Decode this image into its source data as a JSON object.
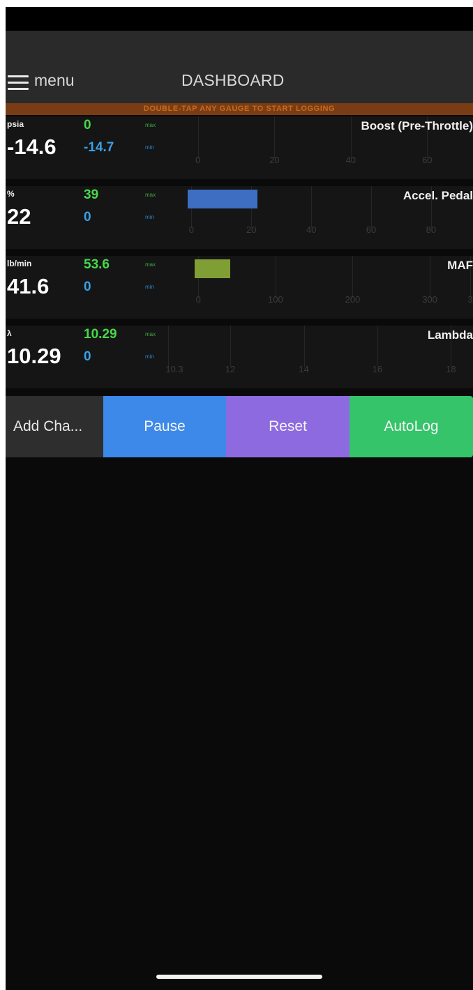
{
  "header": {
    "menu_label": "menu",
    "title": "DASHBOARD",
    "banner": "DOUBLE-TAP ANY GAUGE TO START LOGGING"
  },
  "gauges": [
    {
      "name": "Boost (Pre-Throttle)",
      "unit": "psia",
      "value": "-14.6",
      "max": "0",
      "min": "-14.7",
      "max_label": "max",
      "min_label": "min",
      "scale": {
        "min": -8,
        "max": 72,
        "ticks": [
          0,
          20,
          40,
          60
        ]
      },
      "bar_value": null,
      "bar_color": null
    },
    {
      "name": "Accel. Pedal",
      "unit": "%",
      "value": "22",
      "max": "39",
      "min": "0",
      "max_label": "max",
      "min_label": "min",
      "scale": {
        "min": -8,
        "max": 94,
        "ticks": [
          0,
          20,
          40,
          60,
          80
        ]
      },
      "bar_value": 22,
      "bar_color": "#3d6ec2"
    },
    {
      "name": "MAF",
      "unit": "lb/min",
      "value": "41.6",
      "max": "53.6",
      "min": "0",
      "max_label": "max",
      "min_label": "min",
      "scale": {
        "min": -40,
        "max": 356,
        "ticks": [
          0,
          100,
          200,
          300,
          "3"
        ]
      },
      "bar_value": 41.6,
      "bar_color": "#7f9e33"
    },
    {
      "name": "Lambda",
      "unit": "λ",
      "value": "10.29",
      "max": "10.29",
      "min": "0",
      "max_label": "max",
      "min_label": "min",
      "scale": {
        "min": 10.29,
        "max": 18.6,
        "ticks": [
          10.3,
          12,
          14,
          16,
          18
        ]
      },
      "bar_value": null,
      "bar_color": null
    }
  ],
  "buttons": {
    "add": "Add Cha...",
    "pause": "Pause",
    "reset": "Reset",
    "autolog": "AutoLog"
  },
  "colors": {
    "max_value": "#47d94a",
    "min_value": "#3aa0e8",
    "banner_bg": "#7a3c14",
    "banner_text": "#c56c1e",
    "pause": "#3c89ea",
    "reset": "#8e6ae0",
    "autolog": "#35c46a"
  }
}
